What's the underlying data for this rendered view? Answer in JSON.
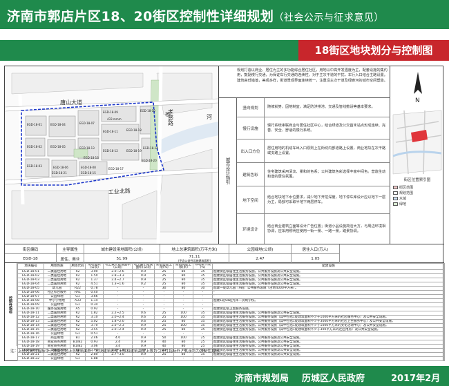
{
  "header": {
    "title": "济南市郭店片区18、20街区控制性详细规划",
    "subtitle": "（社会公示与征求意见）"
  },
  "subtab": "18街区地块划分与控制图",
  "map": {
    "roads": [
      "唐山大道",
      "工业北路",
      "孝感路",
      "杨"
    ],
    "river": "河",
    "blocks": [
      "EGD-18-01",
      "EGD-18-02",
      "EGD-18-03",
      "EGD-18-04",
      "EGD-18-05",
      "EGD-18-06",
      "EGD-18-07",
      "EGD-18-08",
      "EGD-18-09",
      "EGD-18-10",
      "EGD-18-11",
      "EGD-18-12",
      "EGD-18-13",
      "EGD-18-14",
      "EGD-18-15",
      "EGD-18-16",
      "EGD-18-17",
      "EGD-18-18",
      "EGD-18-19",
      "EGD-18-20",
      "EGD-18-21"
    ],
    "area_label": "433 mmm"
  },
  "guidelines": {
    "intro": "规划打造以商业、居住为主的多功能综合居住社区，用地以中高开发强度为主，配套设施的集约用，鼓励慢行交通，为保证车行交通的连续性，对于主次干道的干扰，车行入口结合主路设置。建筑高低错落，美观多样，街道景观界面连续统一，注重沿主次干道及绿廊河的城市空间塑造。",
    "side_label": "城市设计指引",
    "rows": [
      {
        "k": "竖向规划",
        "v": "随坡就势，因地制宜，满足防洪排涝、交通及管线敷设等基本要求。"
      },
      {
        "k": "慢行设施",
        "v": "慢行系统串联商业与居住社区中心，结合绿道及公交首末站点形成连续、完善、安全、舒适的慢行系统。"
      },
      {
        "k": "出入口方位",
        "v": "居住用地的机动车出入口原则上在街坊内部道路上设置，商业地块在次干路或支路上设置。"
      },
      {
        "k": "建筑色彩",
        "v": "住宅建筑采用清淡、柔和的色系；公共建筑色彩选择丰富中间色。营造生动和谐的居住氛围。"
      },
      {
        "k": "地下空间",
        "v": "结合地块地下水位要求，减少地下开挖深度，地下停车库设计应以地下一层为主，局部可采取半地下两层停车。"
      },
      {
        "k": "环境设计",
        "v": "结合商业建筑立面等设计广告位置；街道小品设施简洁大方，与周边环境相协调，应采用照明应使用一街一景、一路一景，路景协调。"
      }
    ]
  },
  "locator": {
    "north": "N",
    "caption": "街区位置索引图",
    "legend": [
      {
        "label": "街区范围",
        "color": "#f1c9c9"
      },
      {
        "label": "规划范围",
        "color": "#ffffff"
      },
      {
        "label": "水域",
        "color": "#cfe2f3"
      },
      {
        "label": "绿地",
        "color": "#d9ead3"
      }
    ]
  },
  "summary": {
    "headers": [
      "街区编码",
      "主导属性",
      "城市建设用地面积(公顷)",
      "地上总建筑面积(万平方米)",
      "公园绿地(公顷)",
      "居住人口(万人)"
    ],
    "values": [
      "EGD-18",
      "居住、商业",
      "51.99",
      "71.11",
      "2.47",
      "1.05"
    ],
    "sub_note": "(不含公益性设施建筑面积)"
  },
  "control_table": {
    "side_label": "控制性指标",
    "headers": [
      "地块编号",
      "用地性质",
      "用地代码",
      "用地面积(公顷)",
      "地上最大建设面积(公顷)",
      "地下最小建设面积(公顷)",
      "建筑密度上限(%)",
      "建筑高度上限(米)",
      "绿地率下限(%)",
      "配建设施"
    ],
    "rows": [
      [
        "EGD-18-01",
        "二类居住用地",
        "R2",
        "3.00",
        "2.0~2.6",
        "0.9",
        "25",
        "80",
        "35",
        "配建街区级居住生活服务设施。公共服务设施及公共安全设施。"
      ],
      [
        "EGD-18-02",
        "二类居住用地",
        "R2",
        "1.50",
        "2.8~3.3",
        "0.9",
        "25",
        "80",
        "35",
        "配建街区级居住生活服务设施。公共服务设施及公共安全设施。"
      ],
      [
        "EGD-18-03",
        "二类居住用地",
        "R2",
        "1.37",
        "2.4~2.7",
        "0.9",
        "25",
        "80",
        "35",
        "配建街区级居住生活服务设施。公共服务设施及公共安全设施。"
      ],
      [
        "EGD-18-04",
        "二类居住用地",
        "R2",
        "4.51",
        "1.3~1.6",
        "0.2",
        "25",
        "80",
        "35",
        "配建街区级居住生活服务设施。公共服务设施及公共安全设施。"
      ],
      [
        "EGD-18-05",
        "幼儿园",
        "R22",
        "0.78",
        "-",
        "-",
        "30",
        "80",
        "30",
        "配建一处幼儿园（9班）公共服务设施（占地4000平方米）。"
      ],
      [
        "EGD-18-06",
        "社区综合服务",
        "RA1",
        "0.40",
        "-",
        "-",
        "-",
        "-",
        "-",
        "-"
      ],
      [
        "EGD-18-07",
        "公园绿地",
        "G1",
        "3.66",
        "-",
        "-",
        "-",
        "-",
        "-",
        "-"
      ],
      [
        "EGD-18-08",
        "中小学用地",
        "A33",
        "1.14",
        "-",
        "-",
        "-",
        "-",
        "-",
        "配建1处54班九年一贯制学校。"
      ],
      [
        "EGD-18-09",
        "公园绿地",
        "G1",
        "0.34",
        "-",
        "-",
        "-",
        "-",
        "-",
        "-"
      ],
      [
        "EGD-18-10",
        "服务设施用地",
        "A5",
        "0.92",
        "-",
        "-",
        "-",
        "-",
        "-",
        "配建街区级卫生服务设施。"
      ],
      [
        "EGD-18-11",
        "二类居住用地",
        "R2",
        "1.82",
        "2.2~2.5",
        "0.6",
        "25",
        "100",
        "35",
        "配建街区级居住生活服务设施。公共服务设施及公共安全设施。"
      ],
      [
        "EGD-18-12",
        "二类居住用地",
        "R2",
        "3.10",
        "2.0~2.4",
        "0.6",
        "25",
        "100",
        "35",
        "配建街区级居住生活服务设施。公共服务设施（其中包括1处建筑面积不少于1000平方米的社区服务中心）及公共安全设施。"
      ],
      [
        "EGD-18-13",
        "二类居住用地",
        "R2",
        "5.02",
        "1.8~2.0",
        "0.6",
        "25",
        "80",
        "35",
        "配建街区级居住生活服务设施。公共服务设施（其中包括1处建筑面积不少于3000平方米的社区卫生服务中心）及公共安全设施。"
      ],
      [
        "EGD-18-14",
        "二类居住用地",
        "R2",
        "3.70",
        "2.0~2.3",
        "0.9",
        "25",
        "100",
        "35",
        "配建街区级居住生活服务设施。公共服务设施（其中包括1处建筑面积不少于1000平方米的文化活动中心）及公共安全设施。"
      ],
      [
        "EGD-18-15",
        "二类居住用地",
        "R2",
        "3.55",
        "2.0~2.4",
        "0.9",
        "25",
        "80",
        "35",
        "配建街区级居住生活服务设施。公共服务设施（其中包括1处建筑面积不少于300平方米的社区用房）及公共安全设施。"
      ],
      [
        "EGD-18-16",
        "公园绿地",
        "G1",
        "0.51",
        "-",
        "-",
        "-",
        "-",
        "-",
        "-"
      ],
      [
        "EGD-18-17",
        "商业用地",
        "B1",
        "2.46",
        "4.0",
        "0.9",
        "50",
        "100",
        "25",
        "配建街区级居住生活服务设施。公共服务设施及公共安全设施。"
      ],
      [
        "EGD-18-18",
        "商业商务用地",
        "B1/B2",
        "0.93",
        "2.4",
        "0.9",
        "40",
        "80",
        "25",
        "配建街区级居住生活服务设施。公共服务设施及公共安全设施。"
      ],
      [
        "EGD-18-19",
        "商业商务用地",
        "B1/B2",
        "3.06",
        "3.4",
        "0.9",
        "40",
        "80",
        "25",
        "配建街区级居住生活服务设施。公共服务设施及公共安全设施。"
      ],
      [
        "EGD-18-20",
        "二类居住用地",
        "R2",
        "3.97",
        "1.5~1.8",
        "0.9",
        "25",
        "80",
        "35",
        "配建街区级居住生活服务设施。公共服务设施及公共安全设施。"
      ],
      [
        "EGD-18-21",
        "二类居住用地",
        "R2",
        "2.80",
        "2.7~3.0",
        "0.9",
        "25",
        "80",
        "35",
        "配建街区级居住生活服务设施。公共服务设施及公共安全设施。"
      ],
      [
        "EGD-18-22",
        "公园绿地",
        "G1",
        "1.88",
        "-",
        "-",
        "-",
        "-",
        "-",
        "-"
      ]
    ]
  },
  "note": "注：上述控制性指标中，除街区地上总建筑面积、地块建筑密度上限和建筑高度上限为引导性指标外，其余均为强制性指标。",
  "footer": {
    "org1": "济南市规划局",
    "org2": "历城区人民政府",
    "date": "2017年2月"
  }
}
